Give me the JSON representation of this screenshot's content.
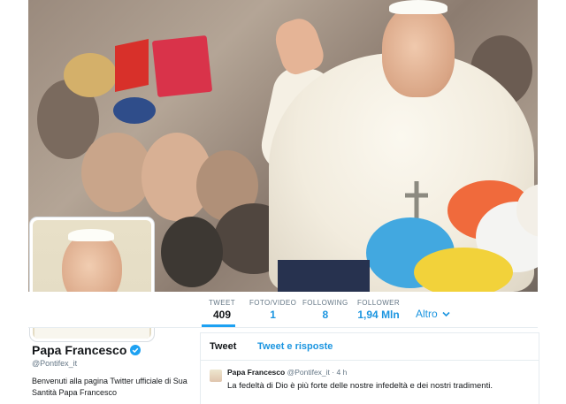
{
  "profile": {
    "name": "Papa Francesco",
    "handle": "@Pontifex_it",
    "bio": "Benvenuti alla pagina Twitter ufficiale di Sua Santità Papa Francesco"
  },
  "nav": {
    "items": [
      {
        "label": "TWEET",
        "value": "409"
      },
      {
        "label": "FOTO/VIDEO",
        "value": "1"
      },
      {
        "label": "FOLLOWING",
        "value": "8"
      },
      {
        "label": "FOLLOWER",
        "value": "1,94 Mln"
      }
    ],
    "more_label": "Altro"
  },
  "timeline": {
    "tabs": [
      "Tweet",
      "Tweet e risposte"
    ],
    "tweet": {
      "name": "Papa Francesco",
      "handle": "@Pontifex_it",
      "sep": "·",
      "time": "4 h",
      "text": "La fedeltà di Dio è più forte delle nostre infedeltà e dei nostri tradimenti."
    }
  },
  "colors": {
    "accent": "#1da1f2",
    "link": "#1b95e0",
    "muted": "#657786"
  },
  "icons": {
    "verified": "verified-badge-icon",
    "chevron": "chevron-down-icon"
  }
}
